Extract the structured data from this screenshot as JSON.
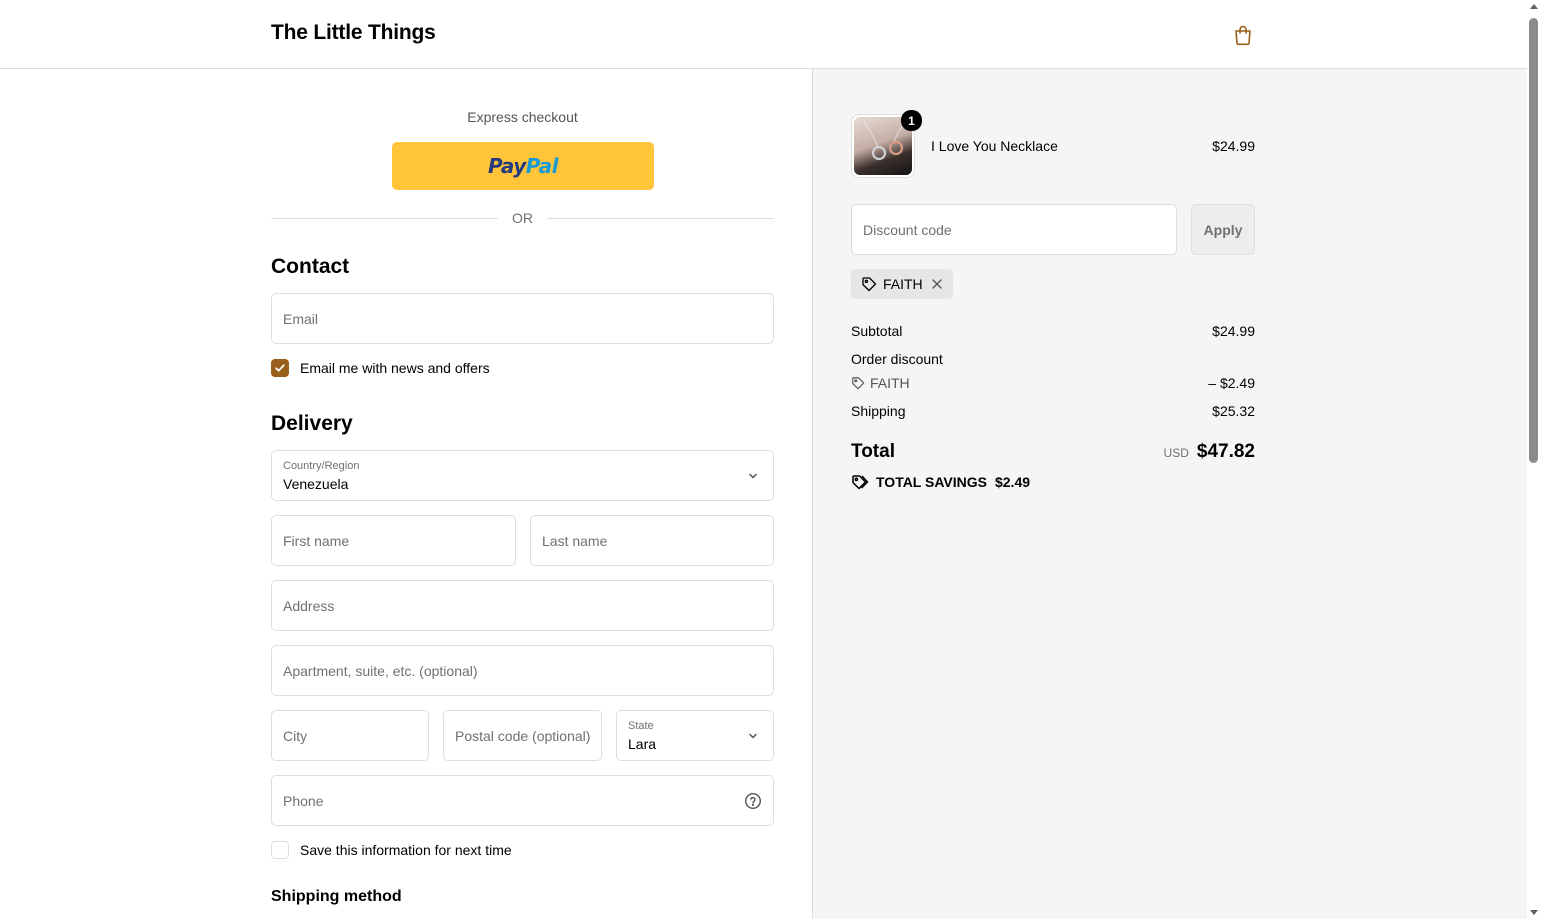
{
  "header": {
    "store_name": "The Little Things"
  },
  "express": {
    "label": "Express checkout",
    "paypal_pay": "Pay",
    "paypal_pal": "Pal",
    "divider": "OR"
  },
  "contact": {
    "title": "Contact",
    "email_placeholder": "Email",
    "newsletter_label": "Email me with news and offers",
    "newsletter_checked": true
  },
  "delivery": {
    "title": "Delivery",
    "country_label": "Country/Region",
    "country_value": "Venezuela",
    "first_name_placeholder": "First name",
    "last_name_placeholder": "Last name",
    "address_placeholder": "Address",
    "apartment_placeholder": "Apartment, suite, etc. (optional)",
    "city_placeholder": "City",
    "postal_placeholder": "Postal code (optional)",
    "state_label": "State",
    "state_value": "Lara",
    "phone_placeholder": "Phone",
    "save_info_label": "Save this information for next time",
    "save_info_checked": false
  },
  "shipping_method": {
    "title": "Shipping method"
  },
  "summary": {
    "product": {
      "name": "I Love You Necklace",
      "price": "$24.99",
      "quantity": "1"
    },
    "discount_placeholder": "Discount code",
    "apply_label": "Apply",
    "applied_code": "FAITH",
    "subtotal_label": "Subtotal",
    "subtotal_value": "$24.99",
    "order_discount_label": "Order discount",
    "order_discount_code": "FAITH",
    "order_discount_value": "– $2.49",
    "shipping_label": "Shipping",
    "shipping_value": "$25.32",
    "total_label": "Total",
    "currency": "USD",
    "total_value": "$47.82",
    "savings_label": "TOTAL SAVINGS",
    "savings_value": "$2.49"
  },
  "colors": {
    "accent": "#9a5f1b",
    "paypal_yellow": "#ffc439",
    "border": "#dedede",
    "summary_bg": "#f5f5f5"
  },
  "icons": {
    "cart": "shopping-bag-icon",
    "chevron": "chevron-down-icon",
    "help": "question-circle-icon",
    "tag": "tag-icon",
    "close": "close-icon",
    "check": "check-icon"
  }
}
